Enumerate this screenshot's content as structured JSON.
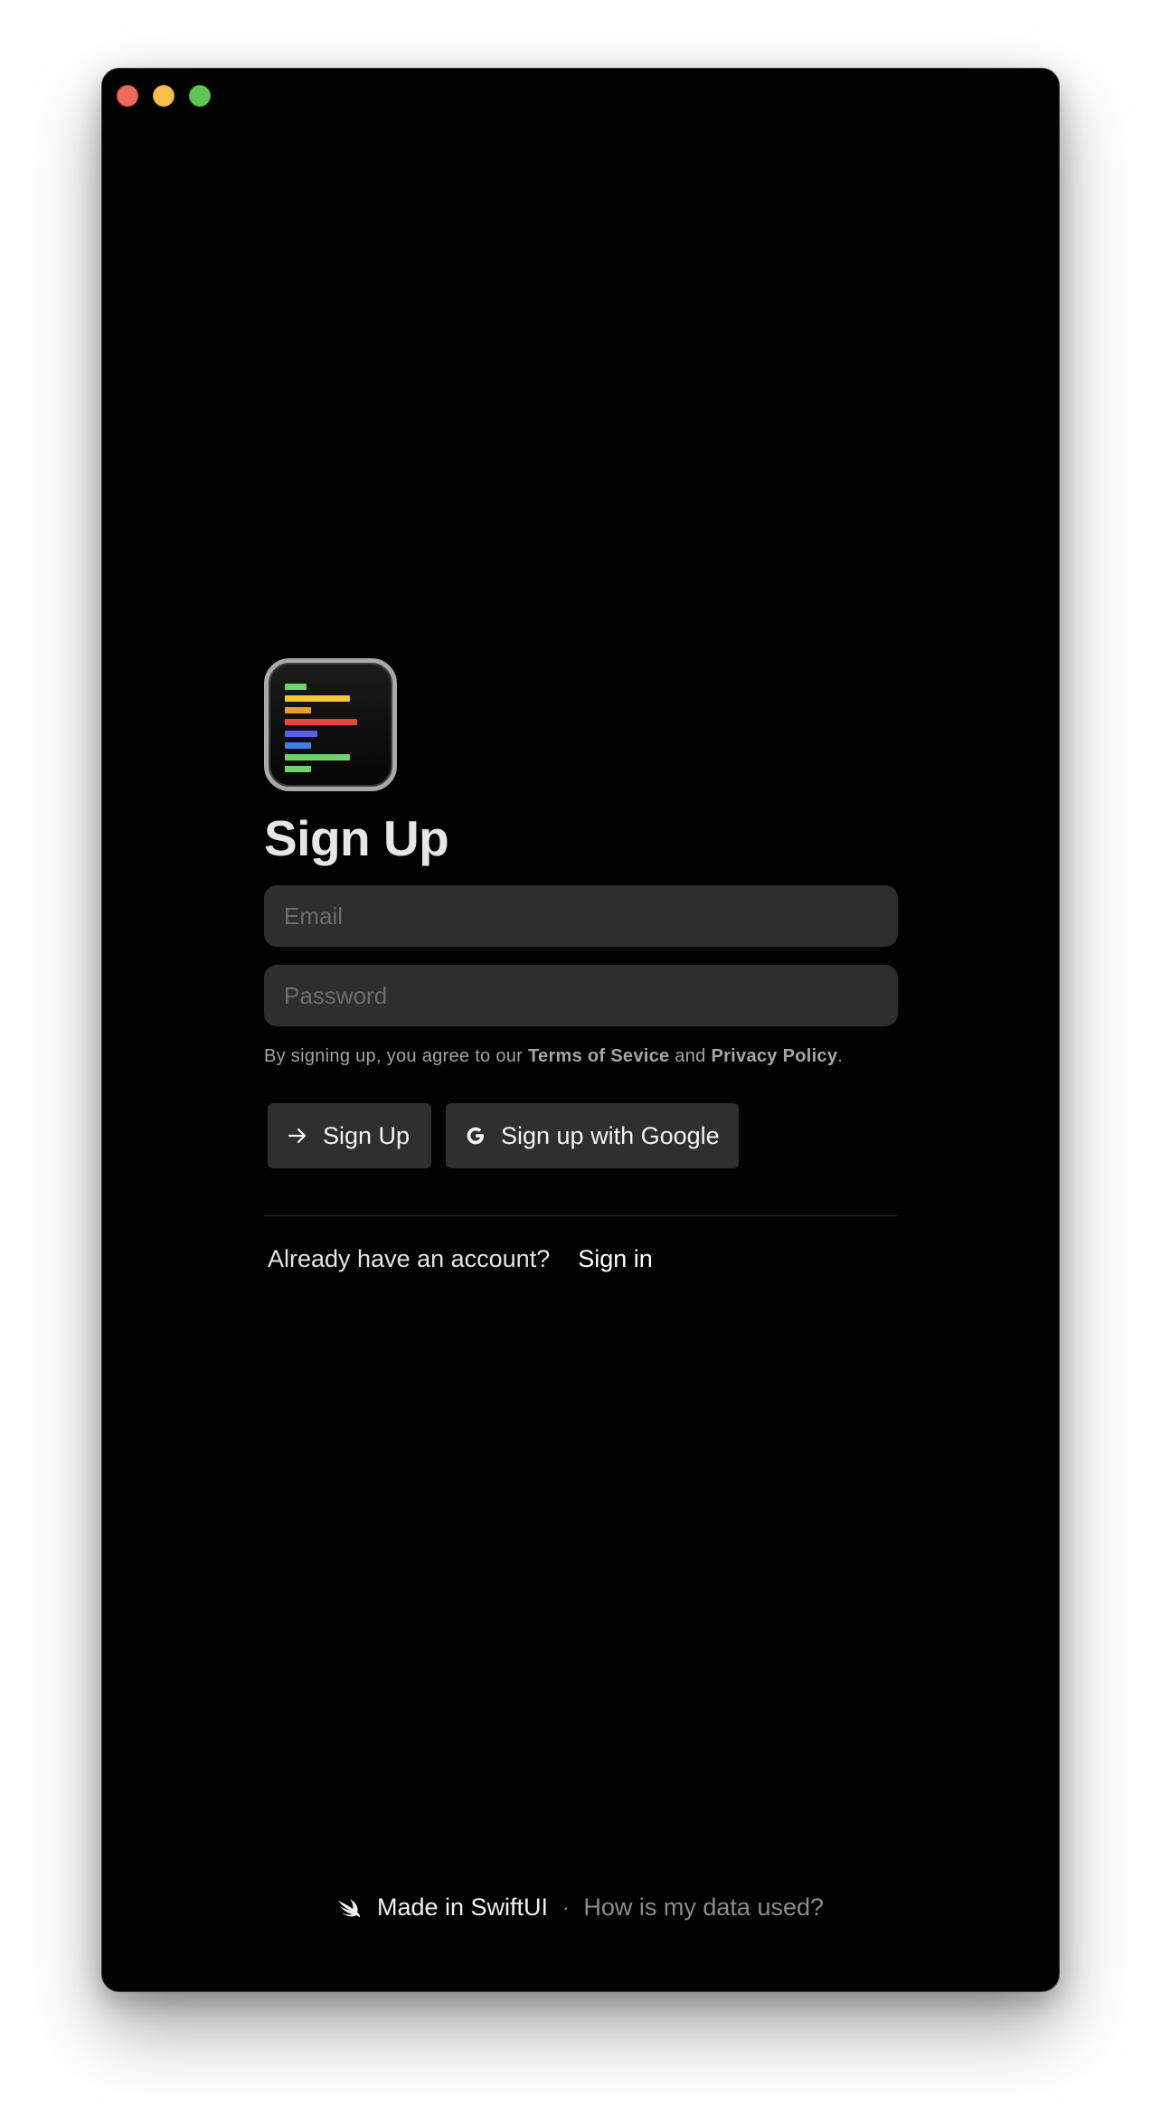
{
  "window": {
    "controls": [
      "close",
      "minimize",
      "zoom"
    ]
  },
  "app_icon": {
    "name": "app-logo-icon",
    "bars": [
      {
        "color": "#6fd36a"
      },
      {
        "color": "#f2c83a"
      },
      {
        "color": "#ee9a33"
      },
      {
        "color": "#e5463f"
      },
      {
        "color": "#5561e6"
      },
      {
        "color": "#3d7ee8"
      },
      {
        "color": "#6fd36a"
      },
      {
        "color": "#6fd36a"
      }
    ]
  },
  "header": {
    "title": "Sign Up"
  },
  "form": {
    "email_placeholder": "Email",
    "password_placeholder": "Password",
    "legal_prefix": "By signing up, you agree to our ",
    "terms_label": "Terms of Sevice",
    "legal_and": " and ",
    "privacy_label": "Privacy Policy",
    "legal_suffix": "."
  },
  "actions": {
    "signup_label": "Sign Up",
    "google_label": "Sign up with Google"
  },
  "signin": {
    "question": "Already have an account?",
    "link_label": "Sign in"
  },
  "footer": {
    "made_label": "Made in SwiftUI",
    "separator": "·",
    "data_link_label": "How is my data used?"
  },
  "colors": {
    "background": "#020202",
    "field": "#2e2e2e",
    "button": "#2f2f2f",
    "text_primary": "#e7e7e7",
    "text_muted": "#8c8c8c"
  }
}
